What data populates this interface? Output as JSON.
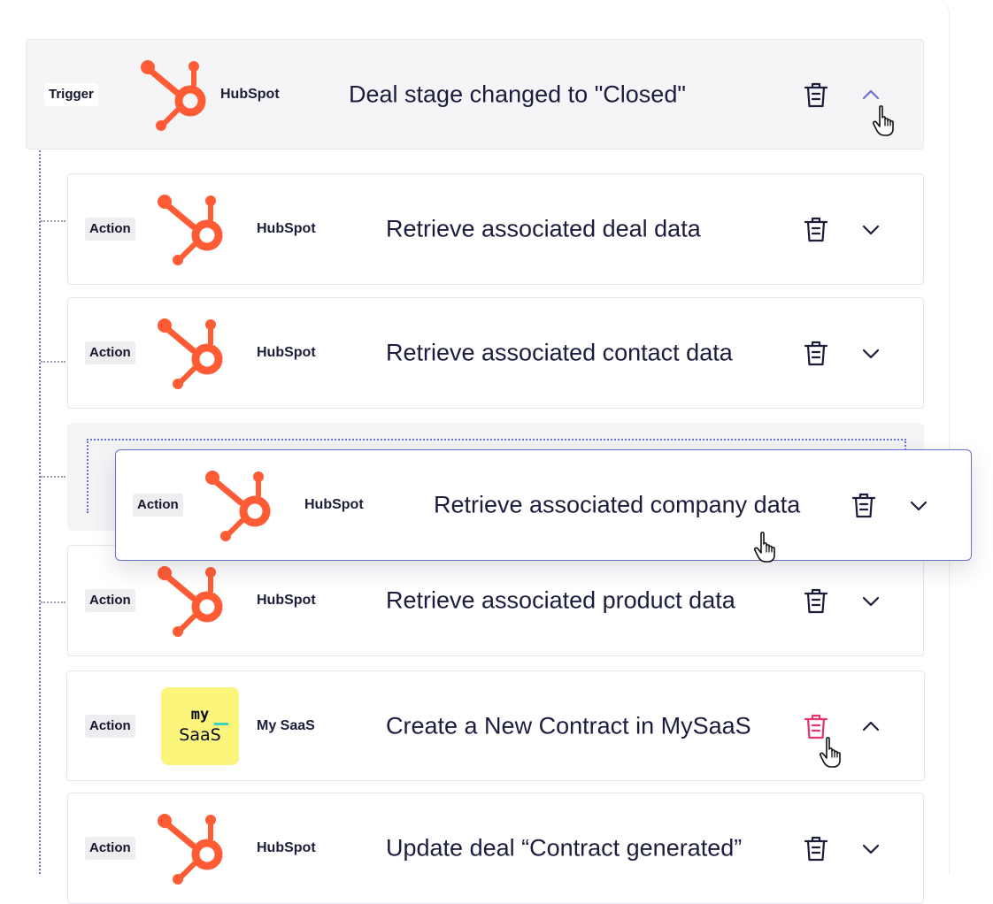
{
  "trigger": {
    "tag": "Trigger",
    "app": "HubSpot",
    "title": "Deal stage changed to \"Closed\"",
    "logo_icon": "hubspot-sprocket-icon",
    "expanded": true
  },
  "actions": [
    {
      "tag": "Action",
      "app": "HubSpot",
      "title": "Retrieve associated deal data",
      "logo_icon": "hubspot-sprocket-icon"
    },
    {
      "tag": "Action",
      "app": "HubSpot",
      "title": "Retrieve associated contact data",
      "logo_icon": "hubspot-sprocket-icon"
    },
    {
      "tag": "Action",
      "app": "HubSpot",
      "title": "Retrieve associated company data",
      "logo_icon": "hubspot-sprocket-icon",
      "state": "dragging"
    },
    {
      "tag": "Action",
      "app": "HubSpot",
      "title": "Retrieve associated product data",
      "logo_icon": "hubspot-sprocket-icon"
    },
    {
      "tag": "Action",
      "app": "My SaaS",
      "title": "Create a New Contract in MySaaS",
      "logo": {
        "line1": "my",
        "line2": "SaaS"
      },
      "delete_hovered": true,
      "expanded": true
    },
    {
      "tag": "Action",
      "app": "HubSpot",
      "title": "Update deal “Contract generated”",
      "logo_icon": "hubspot-sprocket-icon"
    }
  ],
  "icons": {
    "delete": "trash-icon",
    "expand": "chevron-down-icon",
    "collapse": "chevron-up-icon",
    "pointer": "hand-cursor-icon"
  },
  "colors": {
    "hubspot_orange": "#ff5c35",
    "accent": "#6b6fd2",
    "delete_hover": "#e8336b",
    "saas_yellow": "#fbf57c"
  }
}
